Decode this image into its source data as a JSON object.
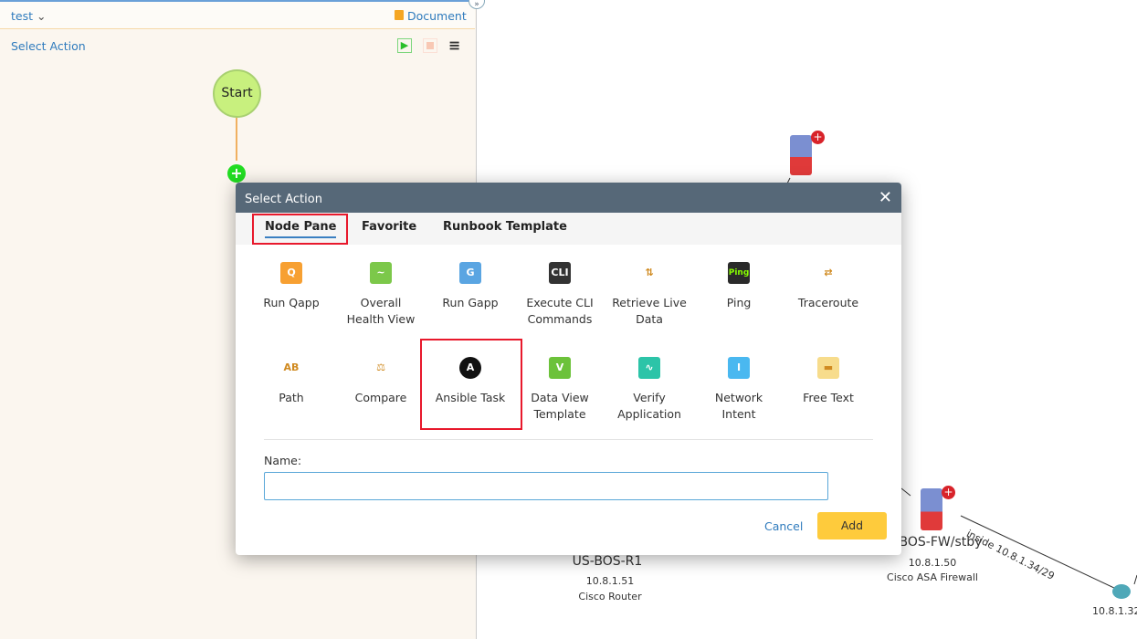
{
  "panel": {
    "title": "test",
    "document_label": "Document",
    "select_action": "Select Action",
    "start_label": "Start"
  },
  "dialog": {
    "title": "Select Action",
    "tabs": [
      "Node Pane",
      "Favorite",
      "Runbook Template"
    ],
    "items": [
      {
        "label": "Run Qapp",
        "icon": "qapp-icon",
        "color": "#f7a032",
        "glyph": "Q"
      },
      {
        "label": "Overall Health View",
        "icon": "health-icon",
        "color": "#7cc84a",
        "glyph": "~"
      },
      {
        "label": "Run Gapp",
        "icon": "gapp-icon",
        "color": "#5aa5e2",
        "glyph": "G"
      },
      {
        "label": "Execute CLI Commands",
        "icon": "cli-icon",
        "color": "#333333",
        "glyph": "CLI"
      },
      {
        "label": "Retrieve Live Data",
        "icon": "live-data-icon",
        "color": "#ffffff",
        "glyph": "⇅"
      },
      {
        "label": "Ping",
        "icon": "ping-icon",
        "color": "#2a2a2a",
        "glyph": "Ping"
      },
      {
        "label": "Traceroute",
        "icon": "traceroute-icon",
        "color": "#ffffff",
        "glyph": "⇄"
      },
      {
        "label": "Path",
        "icon": "path-icon",
        "color": "#ffffff",
        "glyph": "AB"
      },
      {
        "label": "Compare",
        "icon": "compare-icon",
        "color": "#ffffff",
        "glyph": "⚖"
      },
      {
        "label": "Ansible Task",
        "icon": "ansible-icon",
        "color": "#111111",
        "glyph": "A"
      },
      {
        "label": "Data View Template",
        "icon": "data-view-icon",
        "color": "#6cc23a",
        "glyph": "V"
      },
      {
        "label": "Verify Application",
        "icon": "verify-icon",
        "color": "#2cc4a8",
        "glyph": "∿"
      },
      {
        "label": "Network Intent",
        "icon": "intent-icon",
        "color": "#4ab8f0",
        "glyph": "I"
      },
      {
        "label": "Free Text",
        "icon": "free-text-icon",
        "color": "#f7dc8c",
        "glyph": "▬"
      }
    ],
    "name_label": "Name:",
    "name_value": "",
    "cancel": "Cancel",
    "add": "Add"
  },
  "map": {
    "r1": {
      "name": "US-BOS-R1",
      "ip": "10.8.1.51",
      "type": "Cisco Router"
    },
    "fw": {
      "name": "BOS-FW/stby",
      "ip": "10.8.1.50",
      "type": "Cisco ASA Firewall"
    },
    "link": "inside 10.8.1.34/29",
    "router2_ip": "10.8.1.32"
  }
}
